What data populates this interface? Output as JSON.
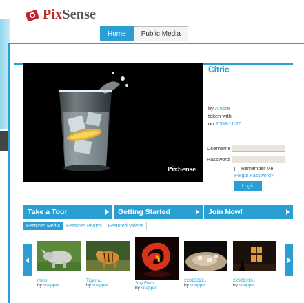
{
  "brand": {
    "name_first": "Pix",
    "name_rest": "Sense"
  },
  "tabs": [
    {
      "label": "Home",
      "active": true
    },
    {
      "label": "Public Media",
      "active": false
    }
  ],
  "featured": {
    "title": "Citric",
    "by_prefix": "by",
    "author": "Amore",
    "taken_with": "taken with",
    "on_prefix": "on",
    "date": "2008-11-20",
    "watermark": "PixSense"
  },
  "login": {
    "username_label": "Username",
    "password_label": "Password",
    "remember_label": "Remember Me",
    "forgot_label": "Forgot Password?",
    "button_label": "Login"
  },
  "cta": [
    {
      "label": "Take a Tour"
    },
    {
      "label": "Getting Started"
    },
    {
      "label": "Join Now!"
    }
  ],
  "media_tabs": [
    {
      "label": "Featured Media",
      "active": true
    },
    {
      "label": "Featured Photos",
      "active": false
    },
    {
      "label": "Featured Videos",
      "active": false
    }
  ],
  "thumbnails": [
    {
      "title": "rhino",
      "by": "by",
      "author": "snapper"
    },
    {
      "title": "Tiger a...",
      "by": "by",
      "author": "snapper"
    },
    {
      "title": "Shy Flam...",
      "by": "by",
      "author": "snapper"
    },
    {
      "title": "22815022...",
      "by": "by",
      "author": "snapper"
    },
    {
      "title": "22929316...",
      "by": "by",
      "author": "snapper"
    }
  ],
  "colors": {
    "accent": "#2a9fd4",
    "brand_red": "#c0262c"
  }
}
